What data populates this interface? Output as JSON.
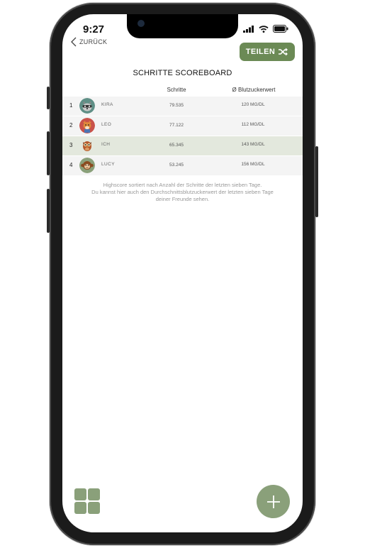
{
  "status_bar": {
    "time": "9:27"
  },
  "nav": {
    "back_label": "ZURÜCK"
  },
  "share_button": {
    "label": "TEILEN"
  },
  "page": {
    "title": "SCHRITTE SCOREBOARD"
  },
  "table": {
    "columns": {
      "steps": "Schritte",
      "sugar": "Ø Blutzuckerwert"
    },
    "rows": [
      {
        "rank": "1",
        "name": "KIRA",
        "steps": "79.535",
        "sugar": "120 MG/DL",
        "avatar": "raccoon-avatar-icon"
      },
      {
        "rank": "2",
        "name": "LEO",
        "steps": "77.122",
        "sugar": "112 MG/DL",
        "avatar": "fox-avatar-icon"
      },
      {
        "rank": "3",
        "name": "ICH",
        "steps": "65.345",
        "sugar": "143 MG/DL",
        "avatar": "owl-avatar-icon"
      },
      {
        "rank": "4",
        "name": "LUCY",
        "steps": "53.245",
        "sugar": "156 MG/DL",
        "avatar": "monkey-avatar-icon"
      }
    ]
  },
  "info": {
    "line1": "Highscore sortiert nach Anzahl der Schritte der letzten sieben Tage.",
    "line2": "Du kannst hier auch den Durchschnittsblutzuckerwert der letzten sieben Tage",
    "line3": "deiner Freunde sehen."
  },
  "colors": {
    "accent": "#6b8a55",
    "accent_light": "#8aa07a",
    "highlight_row": "#e3e8dd"
  }
}
